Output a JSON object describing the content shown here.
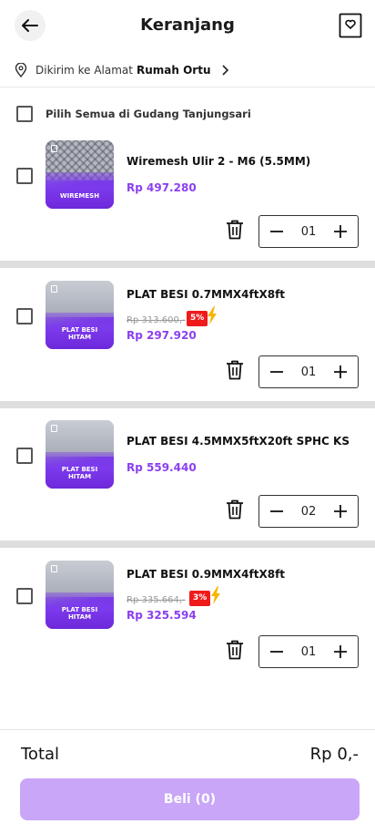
{
  "header": {
    "title": "Keranjang"
  },
  "address": {
    "prefix": "Dikirim ke Alamat",
    "name": "Rumah Ortu"
  },
  "warehouse": {
    "label": "Pilih Semua di",
    "name": "Gudang Tanjungsari"
  },
  "items": [
    {
      "name": "Wiremesh Ulir 2 - M6 (5.5MM)",
      "thumb_label_1": "WIREMESH",
      "thumb_label_2": "",
      "old_price": "",
      "discount": "",
      "price": "Rp 497.280",
      "qty": "01"
    },
    {
      "name": "PLAT BESI 0.7MMX4ftX8ft",
      "thumb_label_1": "PLAT BESI",
      "thumb_label_2": "HITAM",
      "old_price": "Rp 313.600,-",
      "discount": "5%",
      "price": "Rp 297.920",
      "qty": "01"
    },
    {
      "name": "PLAT BESI 4.5MMX5ftX20ft SPHC KS",
      "thumb_label_1": "PLAT BESI",
      "thumb_label_2": "HITAM",
      "old_price": "",
      "discount": "",
      "price": "Rp 559.440",
      "qty": "02"
    },
    {
      "name": "PLAT BESI 0.9MMX4ftX8ft",
      "thumb_label_1": "PLAT BESI",
      "thumb_label_2": "HITAM",
      "old_price": "Rp 335.664,-",
      "discount": "3%",
      "price": "Rp 325.594",
      "qty": "01"
    }
  ],
  "footer": {
    "total_label": "Total",
    "total_value": "Rp 0,-",
    "buy_label": "Beli (0)"
  },
  "colors": {
    "accent": "#8b3ff0",
    "discount": "#ef1b1b",
    "buy_disabled": "#c9a6f7"
  }
}
